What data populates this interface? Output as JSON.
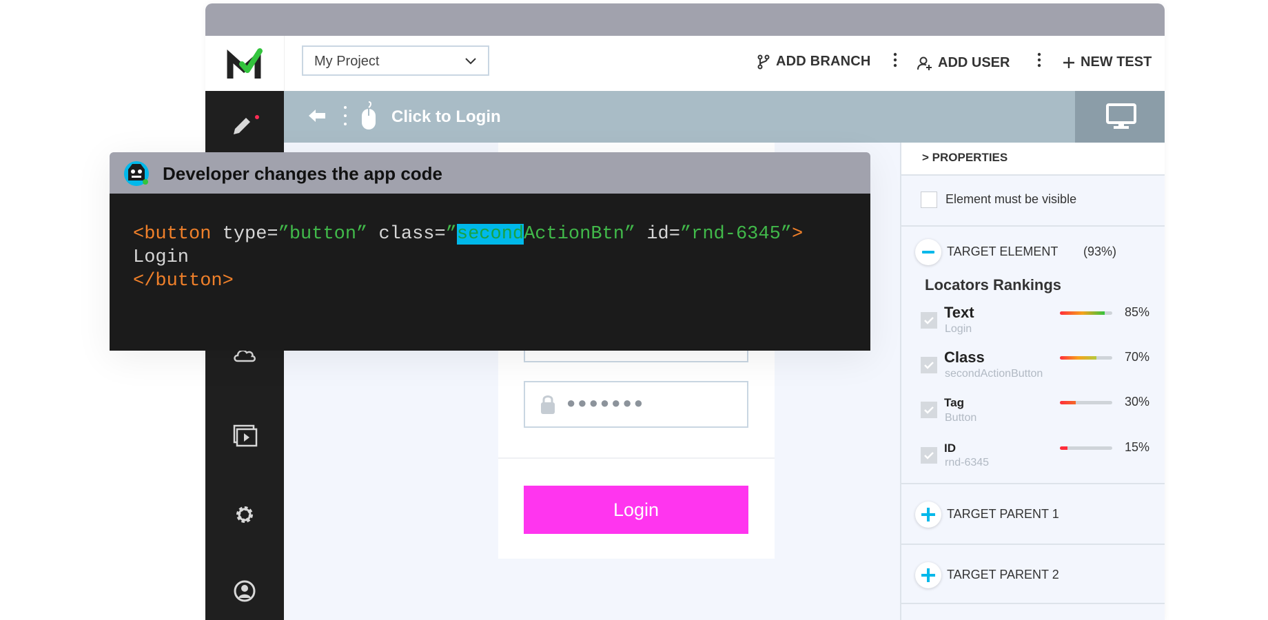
{
  "app": {
    "project_select": {
      "value": "My Project"
    },
    "header_actions": {
      "add_branch": "ADD BRANCH",
      "add_user": "ADD USER",
      "new_test": "NEW TEST"
    },
    "sidebar_icons": [
      "pencil-icon",
      "cloud-icon",
      "media-icon",
      "gear-icon",
      "user-icon"
    ],
    "step": {
      "title": "Click to Login"
    }
  },
  "login_form": {
    "password_mask": "●●●●●●●",
    "login_button": "Login",
    "button_color": "#ff35ef"
  },
  "properties": {
    "header": "> PROPERTIES",
    "visible_checkbox": {
      "label": "Element must be visible",
      "checked": false
    },
    "target_element": {
      "label": "TARGET ELEMENT",
      "score": "(93%)"
    },
    "rankings_title": "Locators Rankings",
    "locators": [
      {
        "name": "Text",
        "value": "Login",
        "pct": "85%",
        "level": 0.85,
        "checked": true
      },
      {
        "name": "Class",
        "value": "secondActionButton",
        "pct": "70%",
        "level": 0.7,
        "checked": true
      },
      {
        "name": "Tag",
        "value": "Button",
        "pct": "30%",
        "level": 0.3,
        "checked": true
      },
      {
        "name": "ID",
        "value": "rnd-6345",
        "pct": "15%",
        "level": 0.15,
        "checked": true
      }
    ],
    "parents": [
      {
        "label": "TARGET PARENT 1"
      },
      {
        "label": "TARGET PARENT 2"
      }
    ]
  },
  "popup": {
    "title": "Developer changes the app code",
    "code": {
      "open_tag": "<button",
      "attr_type": " type=",
      "type_value": "”button”",
      "attr_class": " class=",
      "class_quote": "”",
      "class_highlight": "second",
      "class_rest": "ActionBtn”",
      "attr_id": " id=",
      "id_value": "”rnd-6345”",
      "open_close": ">",
      "inner_text": "Login",
      "close_tag": "</button>"
    }
  },
  "colors": {
    "accent": "#00b8ea",
    "titlebar": "#a1a2ad",
    "stepbar": "#a9bcc6"
  }
}
